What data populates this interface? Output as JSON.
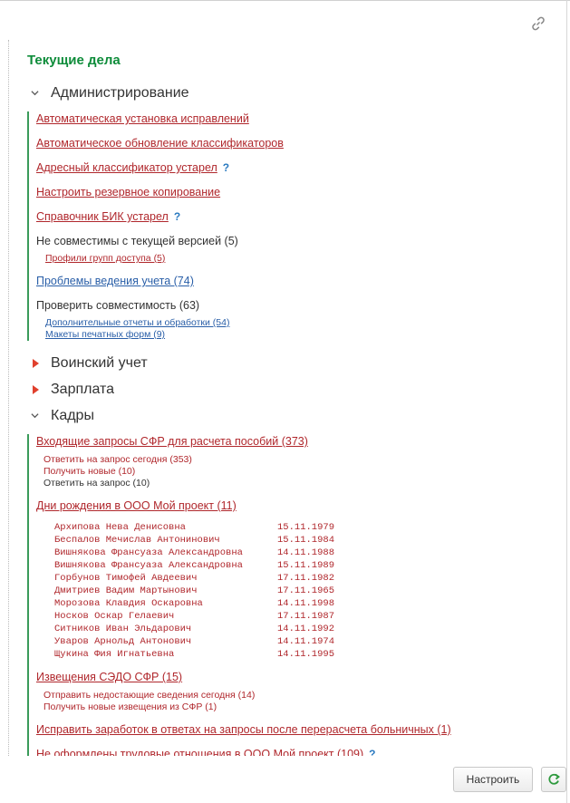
{
  "title": "Текущие дела",
  "sections": {
    "admin": {
      "label": "Администрирование",
      "items": [
        "Автоматическая установка исправлений",
        "Автоматическое обновление классификаторов",
        "Адресный классификатор устарел",
        "Настроить резервное копирование",
        "Справочник БИК устарел"
      ],
      "help_mark": "?",
      "incompatible": {
        "label": "Не совместимы с текущей версией (5)",
        "sub": [
          "Профили групп доступа (5)"
        ]
      },
      "problems": "Проблемы ведения учета (74)",
      "check": {
        "label": "Проверить совместимость (63)",
        "sub": [
          "Дополнительные отчеты и обработки (54)",
          "Макеты печатных форм (9)"
        ]
      }
    },
    "military": {
      "label": "Воинский учет"
    },
    "salary": {
      "label": "Зарплата"
    },
    "hr": {
      "label": "Кадры",
      "requests": {
        "label": "Входящие запросы СФР для расчета пособий (373)",
        "sub": [
          "Ответить на запрос сегодня (353)",
          "Получить новые (10)",
          "Ответить на запрос (10)"
        ]
      },
      "birthdays": {
        "label": "Дни рождения в ООО Мой проект (11)",
        "rows": [
          {
            "name": "Архипова Нева Денисовна",
            "date": "15.11.1979"
          },
          {
            "name": "Беспалов Мечислав Антонинович",
            "date": "15.11.1984"
          },
          {
            "name": "Вишнякова Франсуаза Александровна",
            "date": "14.11.1988"
          },
          {
            "name": "Вишнякова Франсуаза Александровна",
            "date": "15.11.1989"
          },
          {
            "name": "Горбунов Тимофей Авдеевич",
            "date": "17.11.1982"
          },
          {
            "name": "Дмитриев Вадим Мартынович",
            "date": "17.11.1965"
          },
          {
            "name": "Морозова Клавдия Оскаровна",
            "date": "14.11.1998"
          },
          {
            "name": "Носков Оскар Гелаевич",
            "date": "17.11.1987"
          },
          {
            "name": "Ситников Иван Эльдарович",
            "date": "14.11.1992"
          },
          {
            "name": "Уваров Арнольд Антонович",
            "date": "14.11.1974"
          },
          {
            "name": "Щукина Фия Игнатьевна",
            "date": "14.11.1995"
          }
        ]
      },
      "sedo": {
        "label": "Извещения СЭДО СФР (15)",
        "sub": [
          "Отправить недостающие сведения сегодня (14)",
          "Получить новые извещения из СФР (1)"
        ]
      },
      "fix_earnings": "Исправить заработок в ответах на запросы после перерасчета больничных (1)",
      "not_registered": "Не оформлены трудовые отношения в ООО Мой проект (109)"
    }
  },
  "buttons": {
    "configure": "Настроить"
  },
  "colors": {
    "title_green": "#0e8c3a",
    "link_red": "#b0272c",
    "link_blue": "#2a5fa8",
    "bar_green": "#3a9b5a",
    "arrow_red": "#e0402d"
  },
  "icons": {
    "link": "link-icon",
    "refresh": "refresh-icon"
  }
}
